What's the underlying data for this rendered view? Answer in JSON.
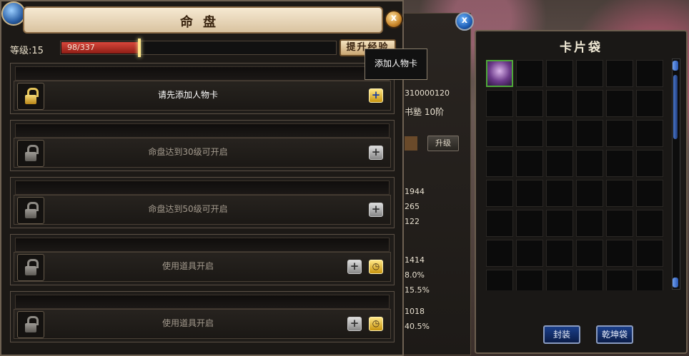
{
  "panel": {
    "title": "命盘",
    "level_label": "等级:15",
    "exp_text": "98/337",
    "exp_progress": 0.291,
    "upgrade_exp_label": "提升经验",
    "tooltip": "添加人物卡"
  },
  "slots": [
    {
      "text": "请先添加人物卡",
      "locked": false
    },
    {
      "text": "命盘达到30级可开启",
      "locked": true
    },
    {
      "text": "命盘达到50级可开启",
      "locked": true
    },
    {
      "text": "使用道具开启",
      "locked": true
    },
    {
      "text": "使用道具开启",
      "locked": true
    }
  ],
  "middle_panel": {
    "values": [
      "310000120",
      "书塾 10阶",
      "1944",
      "265",
      "122",
      "1414",
      "8.0%",
      "15.5%",
      "1018",
      "40.5%"
    ],
    "upgrade_label": "升级"
  },
  "card_bag": {
    "title": "卡片袋",
    "seal_label": "封装",
    "qiankun_label": "乾坤袋"
  },
  "icons": [
    "lock-icon",
    "plus-icon",
    "clock-icon",
    "close-icon",
    "character-card-icon"
  ],
  "colors": {
    "exp_fill": "#c0392b",
    "bag_button": "#1b3f8a",
    "gold": "#d8a528"
  }
}
